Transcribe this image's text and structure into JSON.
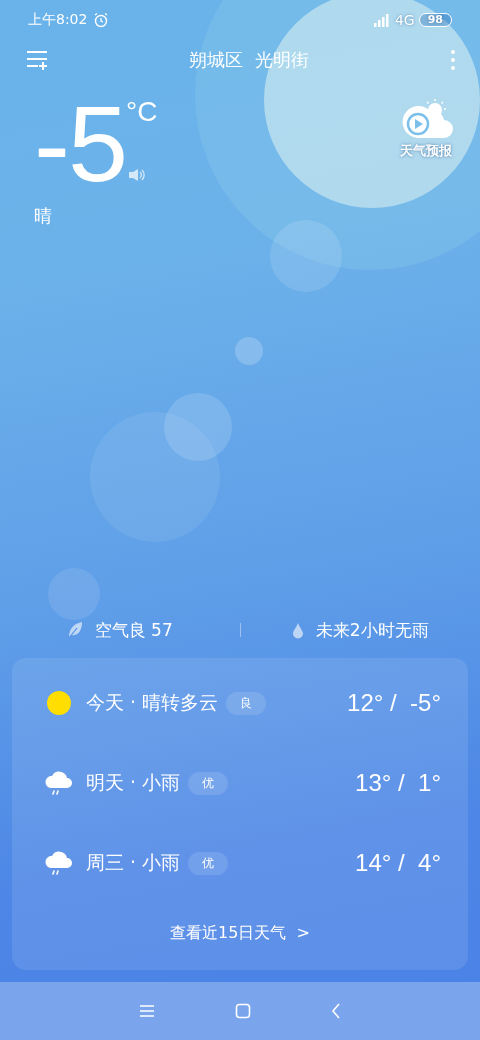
{
  "status_bar": {
    "time": "上午8:02",
    "network": "4G",
    "battery": "98"
  },
  "header": {
    "location": "朔城区  光明街"
  },
  "current": {
    "temperature": "-5",
    "unit": "°C",
    "condition": "晴",
    "forecast_video_label": "天气预报"
  },
  "summary": [
    {
      "kind": "air",
      "text": "空气良 57"
    },
    {
      "kind": "rain",
      "text": "未来2小时无雨"
    }
  ],
  "days": [
    {
      "kind": "sunny",
      "label": "今天 · 晴转多云",
      "air": "良",
      "temps": "12° /  -5°"
    },
    {
      "kind": "rain",
      "label": "明天 · 小雨",
      "air": "优",
      "temps": "13° /  1°"
    },
    {
      "kind": "rain",
      "label": "周三 · 小雨",
      "air": "优",
      "temps": "14° /  4°"
    }
  ],
  "more_link": "查看近15日天气  >"
}
